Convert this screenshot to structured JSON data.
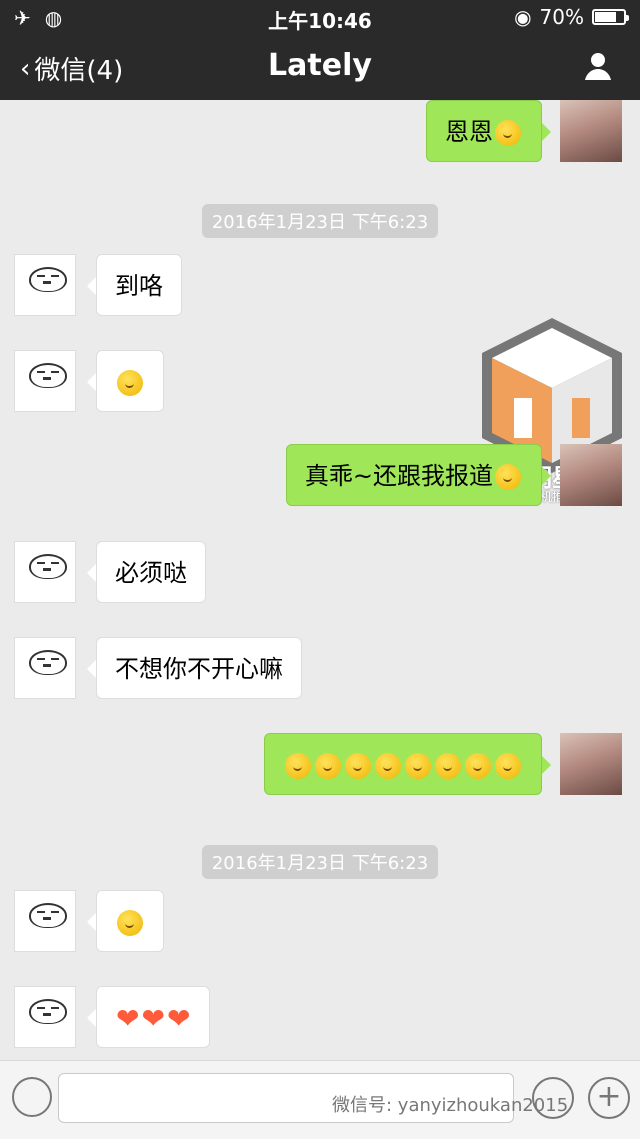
{
  "status_bar": {
    "time": "上午10:46",
    "battery": "70%"
  },
  "nav": {
    "back_label": "微信(4)",
    "title": "Lately"
  },
  "chat": {
    "messages": [
      {
        "from": "other",
        "text": "恩恩",
        "emoji": true
      },
      {
        "timestamp": "2016年1月23日 下午6:23"
      },
      {
        "from": "self",
        "text": "到咯"
      },
      {
        "from": "self",
        "text": "😁"
      },
      {
        "from": "other",
        "text": "真乖~还跟我报道",
        "emoji": true
      },
      {
        "from": "self",
        "text": "必须哒"
      },
      {
        "from": "self",
        "text": "不想你不开心嘛"
      },
      {
        "from": "other",
        "text": "😘😘😘😘😘😘😘😘"
      },
      {
        "timestamp": "2016年1月23日 下午6:23"
      },
      {
        "from": "self",
        "text": "😘"
      },
      {
        "from": "self",
        "text": "❤❤❤"
      }
    ]
  },
  "watermark": {
    "text": "全明星探",
    "subtext": "手机推广"
  },
  "input_bar": {
    "signature": "微信号: yanyizhoukan2015"
  }
}
